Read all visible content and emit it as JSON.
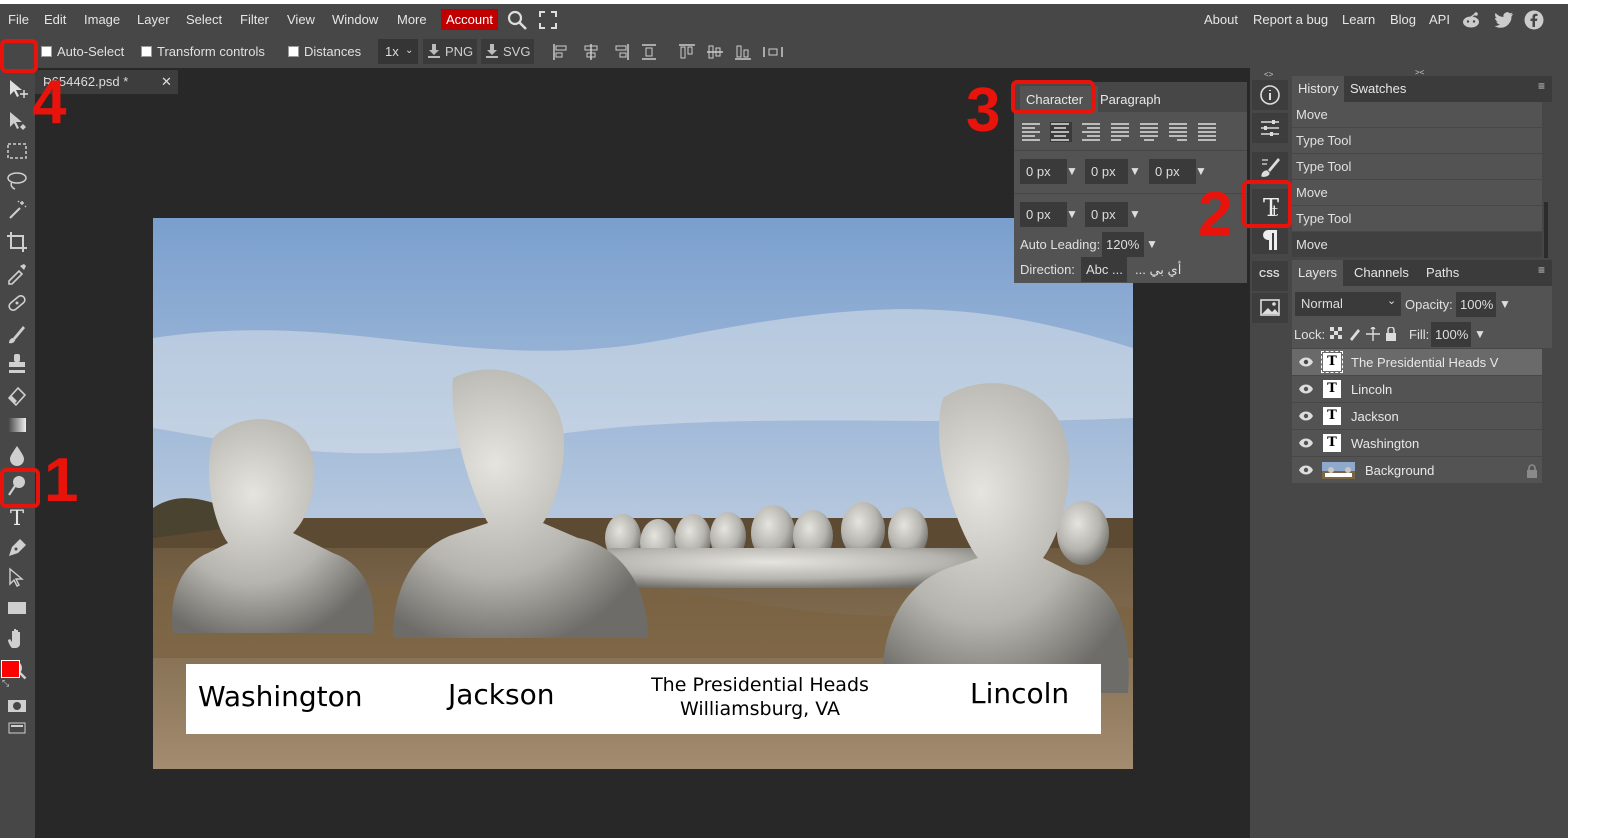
{
  "menu": {
    "items": [
      "File",
      "Edit",
      "Image",
      "Layer",
      "Select",
      "Filter",
      "View",
      "Window",
      "More"
    ],
    "account": "Account",
    "right_links": [
      "About",
      "Report a bug",
      "Learn",
      "Blog",
      "API"
    ]
  },
  "options": {
    "auto_select": "Auto-Select",
    "transform_controls": "Transform controls",
    "distances": "Distances",
    "zoom": "1x",
    "export_png": "PNG",
    "export_svg": "SVG"
  },
  "document": {
    "tab_title": "Ʀ654462.psd *",
    "close": "✕"
  },
  "canvas": {
    "captions": {
      "washington": "Washington",
      "jackson": "Jackson",
      "title_line1": "The Presidential Heads",
      "title_line2": "Williamsburg, VA",
      "lincoln": "Lincoln"
    }
  },
  "character_panel": {
    "tabs": [
      "Character",
      "Paragraph"
    ],
    "row1": [
      "0 px",
      "0 px",
      "0 px"
    ],
    "row2": [
      "0 px",
      "0 px"
    ],
    "auto_leading_label": "Auto Leading:",
    "auto_leading_value": "120%",
    "direction_label": "Direction:",
    "direction_ltr": "Abc ...",
    "direction_rtl": "... أي بي"
  },
  "right_icons": {
    "css": "CSS"
  },
  "history": {
    "tabs": [
      "History",
      "Swatches"
    ],
    "items": [
      "Move",
      "Type Tool",
      "Type Tool",
      "Move",
      "Type Tool",
      "Move"
    ]
  },
  "layers": {
    "tabs": [
      "Layers",
      "Channels",
      "Paths"
    ],
    "blend_mode": "Normal",
    "opacity_label": "Opacity:",
    "opacity": "100%",
    "lock_label": "Lock:",
    "fill_label": "Fill:",
    "fill": "100%",
    "items": [
      {
        "name": "The Presidential Heads V",
        "type": "text",
        "selected": true
      },
      {
        "name": "Lincoln",
        "type": "text"
      },
      {
        "name": "Jackson",
        "type": "text"
      },
      {
        "name": "Washington",
        "type": "text"
      },
      {
        "name": "Background",
        "type": "image",
        "locked": true
      }
    ]
  },
  "annotations": {
    "n1": "1",
    "n2": "2",
    "n3": "3",
    "n4": "4"
  },
  "colors": {
    "accent_red": "#e8140c",
    "account_bg": "#c00000",
    "foreground": "#ff0000",
    "background": "#000000"
  }
}
